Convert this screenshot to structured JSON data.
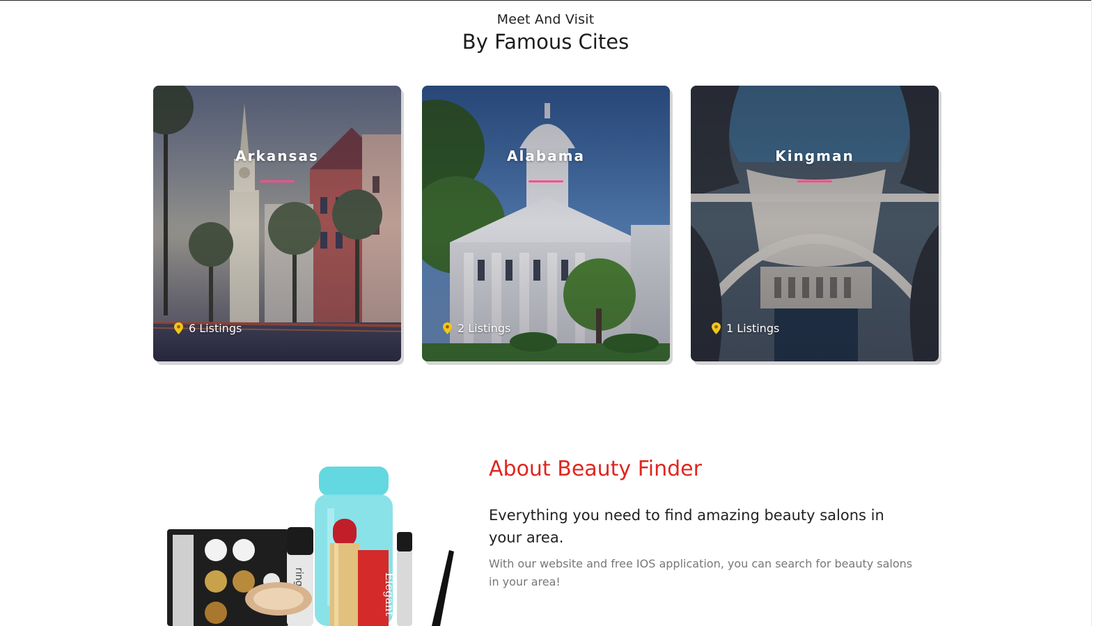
{
  "header": {
    "eyebrow": "Meet And Visit",
    "title": "By Famous Cites"
  },
  "cities": [
    {
      "name": "Arkansas",
      "listings": "6 Listings"
    },
    {
      "name": "Alabama",
      "listings": "2 Listings"
    },
    {
      "name": "Kingman",
      "listings": "1 Listings"
    }
  ],
  "about": {
    "title": "About Beauty Finder",
    "lead": "Everything you need to find amazing beauty salons in your area.",
    "body": "With our website and free IOS application, you can search for beauty salons in your area!"
  },
  "product_labels": {
    "lipstick_brand": "Elegant",
    "mascara_text": "ring"
  },
  "colors": {
    "accent_pink": "#ff4f8b",
    "about_title_red": "#e0261f",
    "pin_yellow": "#f5c518"
  },
  "icons": {
    "listing_pin": "map-pin-icon"
  }
}
